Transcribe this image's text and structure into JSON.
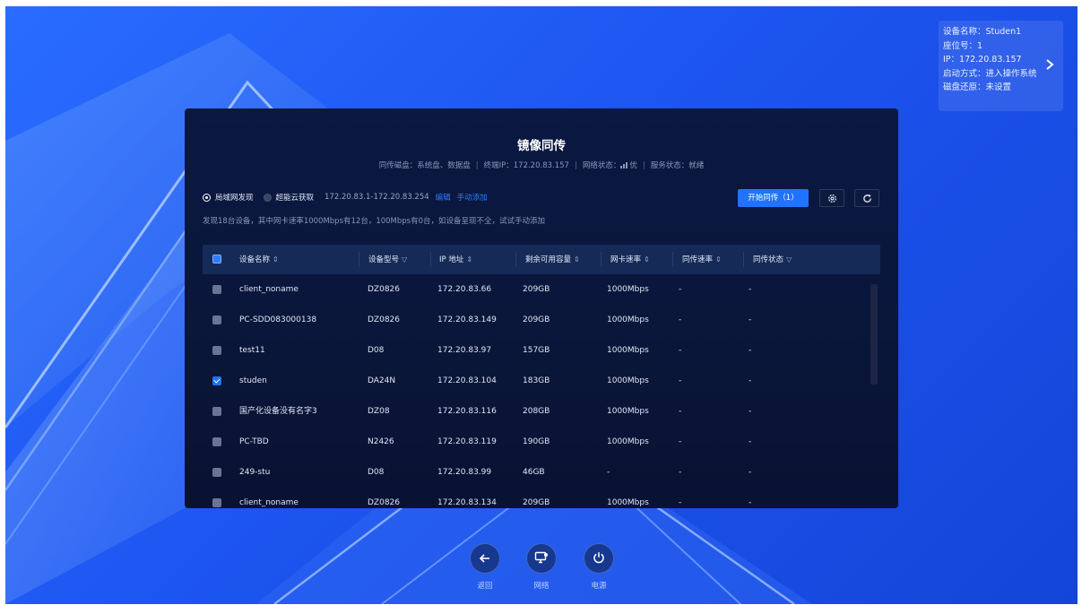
{
  "device_info": {
    "lines": [
      "设备名称：Studen1",
      "座位号：1",
      "IP：172.20.83.157",
      "启动方式：进入操作系统",
      "磁盘还原：未设置"
    ],
    "arrow_icon": "chevron-right-icon"
  },
  "panel": {
    "title": "镜像同传",
    "status_bar": {
      "disk": "同传磁盘：系统盘、数据盘",
      "terminal_ip": "终端IP：172.20.83.157",
      "network_label": "网络状态：",
      "network_value": "优",
      "service": "服务状态：就绪"
    },
    "modes": {
      "lan_label": "局域网发现",
      "cloud_label": "超能云获取",
      "ip_range": "172.20.83.1-172.20.83.254",
      "edit_link": "编辑",
      "manual_link": "手动添加",
      "selected": "lan"
    },
    "hint": "发现18台设备，其中网卡速率1000Mbps有12台，100Mbps有0台，如设备呈现不全，试试手动添加",
    "start_button": "开始同传（1）",
    "settings_icon": "gear-icon",
    "refresh_icon": "refresh-icon",
    "columns": [
      "设备名称",
      "设备型号",
      "IP 地址",
      "剩余可用容量",
      "网卡速率",
      "同传速率",
      "同传状态"
    ],
    "sort_glyph": "⇕",
    "filter_glyph": "▽",
    "rows": [
      {
        "name": "client_noname",
        "model": "DZ0826",
        "ip": "172.20.83.66",
        "capacity": "209GB",
        "nic": "1000Mbps",
        "speed": "-",
        "state": "-",
        "checked": false
      },
      {
        "name": "PC-SDD083000138",
        "model": "DZ0826",
        "ip": "172.20.83.149",
        "capacity": "209GB",
        "nic": "1000Mbps",
        "speed": "-",
        "state": "-",
        "checked": false
      },
      {
        "name": "test11",
        "model": "D08",
        "ip": "172.20.83.97",
        "capacity": "157GB",
        "nic": "1000Mbps",
        "speed": "-",
        "state": "-",
        "checked": false
      },
      {
        "name": "studen",
        "model": "DA24N",
        "ip": "172.20.83.104",
        "capacity": "183GB",
        "nic": "1000Mbps",
        "speed": "-",
        "state": "-",
        "checked": true
      },
      {
        "name": "国产化设备没有名字3",
        "model": "DZ08",
        "ip": "172.20.83.116",
        "capacity": "208GB",
        "nic": "1000Mbps",
        "speed": "-",
        "state": "-",
        "checked": false
      },
      {
        "name": "PC-TBD",
        "model": "N2426",
        "ip": "172.20.83.119",
        "capacity": "190GB",
        "nic": "1000Mbps",
        "speed": "-",
        "state": "-",
        "checked": false
      },
      {
        "name": "249-stu",
        "model": "D08",
        "ip": "172.20.83.99",
        "capacity": "46GB",
        "nic": "-",
        "speed": "-",
        "state": "-",
        "checked": false
      },
      {
        "name": "client_noname",
        "model": "DZ0826",
        "ip": "172.20.83.134",
        "capacity": "209GB",
        "nic": "1000Mbps",
        "speed": "-",
        "state": "-",
        "checked": false
      }
    ]
  },
  "dock": [
    {
      "label": "返回",
      "icon": "arrow-left-icon"
    },
    {
      "label": "网络",
      "icon": "network-icon"
    },
    {
      "label": "电源",
      "icon": "power-icon"
    }
  ],
  "colors": {
    "accent": "#1f73ff",
    "panel_bg": "#0a1842",
    "desktop_bg": "#1d55f0"
  }
}
